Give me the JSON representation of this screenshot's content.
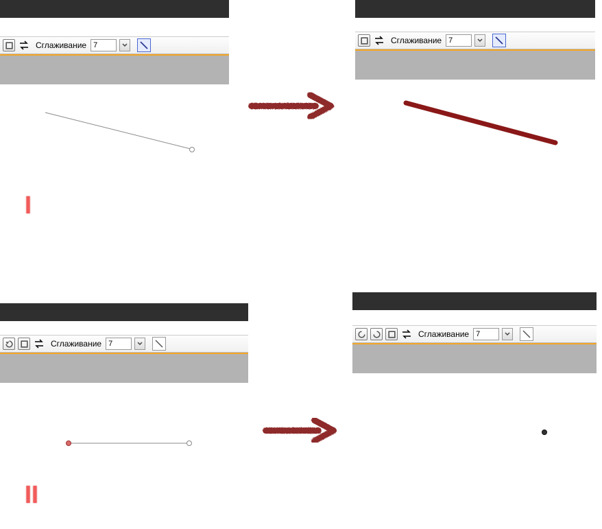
{
  "toolbar": {
    "smoothing_label": "Сглаживание",
    "smoothing_value": "7"
  },
  "markers": {
    "one": "I",
    "two": "II"
  }
}
